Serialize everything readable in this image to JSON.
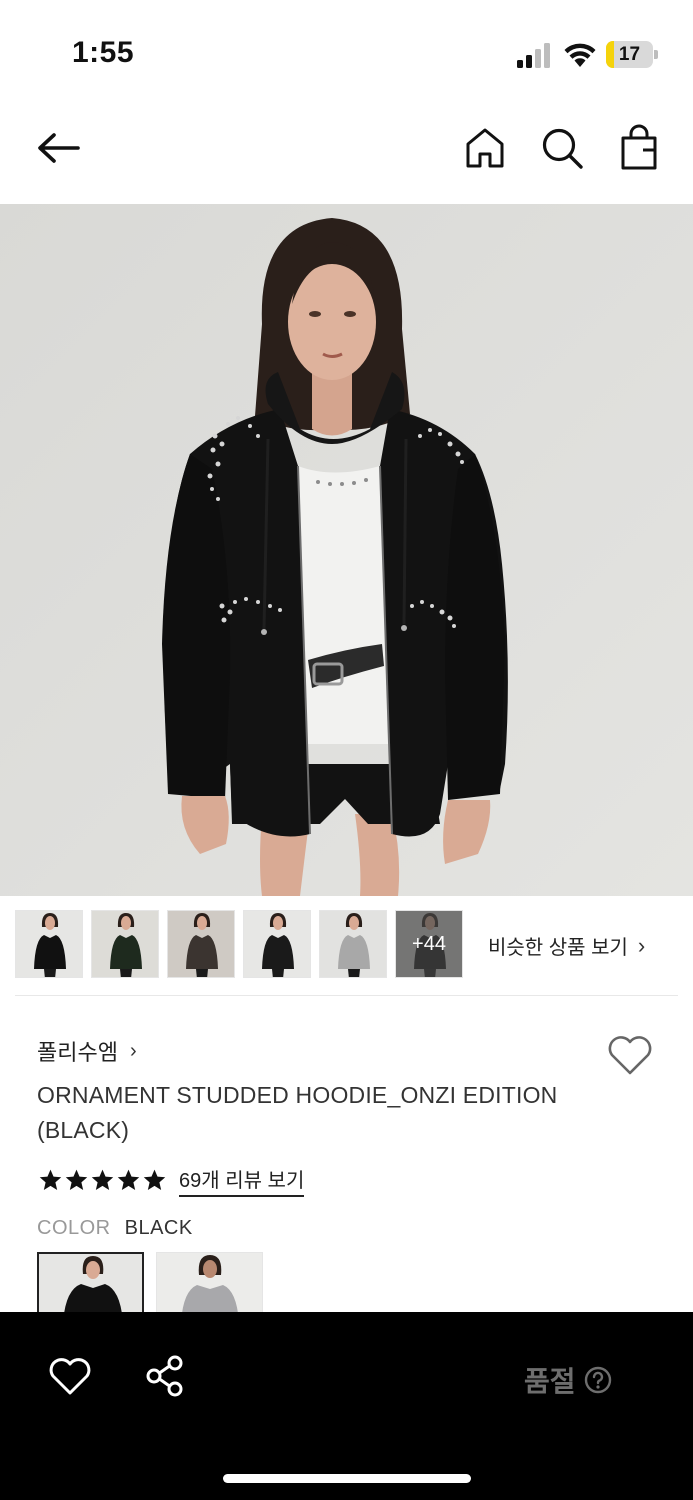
{
  "status_bar": {
    "time": "1:55",
    "battery_level": "17",
    "battery_fraction": 0.17
  },
  "nav": {
    "back_icon": "arrow-left-icon",
    "home_icon": "home-icon",
    "search_icon": "search-icon",
    "bag_icon": "shopping-bag-icon"
  },
  "gallery": {
    "thumbnails": [
      {
        "jacket": "#111111",
        "bg": "#e6e6e4"
      },
      {
        "jacket": "#1e2a1e",
        "bg": "#dddcd7"
      },
      {
        "jacket": "#3b3430",
        "bg": "#cfcac4"
      },
      {
        "jacket": "#1a1a1a",
        "bg": "#e7e7e5"
      },
      {
        "jacket": "#a8a8a8",
        "bg": "#e2e2e0"
      },
      {
        "jacket": "#151515",
        "bg": "#d9d9d7"
      }
    ],
    "more_count": "+44",
    "similar_label": "비슷한 상품 보기",
    "chevron": "›"
  },
  "product": {
    "brand": "폴리수엠",
    "title": "ORNAMENT STUDDED HOODIE_ONZI EDITION (BLACK)",
    "rating": 5,
    "review_link": "69개 리뷰 보기",
    "color_label": "COLOR",
    "color_value": "BLACK"
  },
  "bottom_bar": {
    "soldout_label": "품절",
    "help_icon": "question-circle-icon"
  },
  "colors": {
    "accent_battery": "#f5d30b",
    "bottom_bar": "#000000",
    "soldout_text": "#6e6e6e"
  }
}
